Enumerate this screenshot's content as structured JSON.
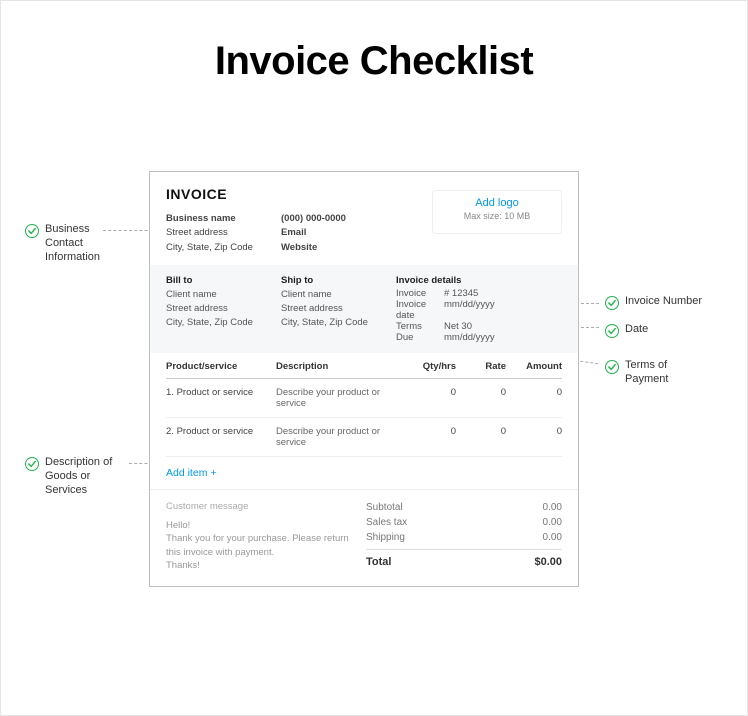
{
  "title": "Invoice Checklist",
  "annotations": {
    "business": "Business\nContact\nInformation",
    "invoiceNumber": "Invoice Number",
    "date": "Date",
    "terms": "Terms of\nPayment",
    "description": "Description of\nGoods or\nServices"
  },
  "invoice": {
    "heading": "INVOICE",
    "business": {
      "nameLabel": "Business name",
      "street": "Street address",
      "cityStateZip": "City, State, Zip Code",
      "phone": "(000) 000-0000",
      "email": "Email",
      "website": "Website"
    },
    "logo": {
      "addLabel": "Add logo",
      "maxSize": "Max size: 10 MB"
    },
    "billTo": {
      "header": "Bill to",
      "client": "Client name",
      "street": "Street address",
      "cityStateZip": "City, State, Zip Code"
    },
    "shipTo": {
      "header": "Ship to",
      "client": "Client name",
      "street": "Street address",
      "cityStateZip": "City, State, Zip Code"
    },
    "details": {
      "header": "Invoice details",
      "invoiceLabel": "Invoice",
      "invoiceValue": "# 12345",
      "dateLabel": "Invoice date",
      "dateValue": "mm/dd/yyyy",
      "termsLabel": "Terms",
      "termsValue": "Net 30",
      "dueLabel": "Due",
      "dueValue": "mm/dd/yyyy"
    },
    "columns": {
      "product": "Product/service",
      "description": "Description",
      "qty": "Qty/hrs",
      "rate": "Rate",
      "amount": "Amount"
    },
    "rows": [
      {
        "num": "1.",
        "product": "Product or service",
        "desc": "Describe your product or service",
        "qty": "0",
        "rate": "0",
        "amount": "0"
      },
      {
        "num": "2.",
        "product": "Product or service",
        "desc": "Describe your product or service",
        "qty": "0",
        "rate": "0",
        "amount": "0"
      }
    ],
    "addItem": "Add item +",
    "message": {
      "title": "Customer message",
      "body": "Hello!\nThank you for your purchase. Please return this invoice with payment.\nThanks!"
    },
    "totals": {
      "subtotalLabel": "Subtotal",
      "subtotalValue": "0.00",
      "taxLabel": "Sales tax",
      "taxValue": "0.00",
      "shippingLabel": "Shipping",
      "shippingValue": "0.00",
      "totalLabel": "Total",
      "totalValue": "$0.00"
    }
  }
}
